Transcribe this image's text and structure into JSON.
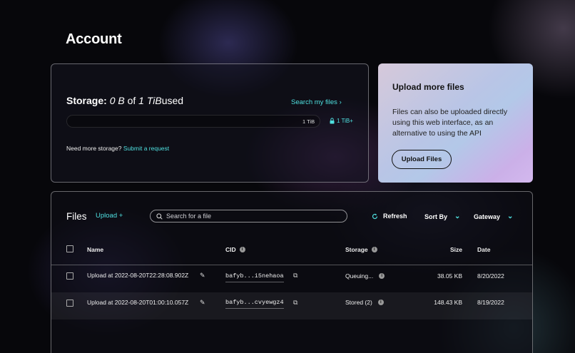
{
  "page": {
    "title": "Account"
  },
  "storage": {
    "label": "Storage:",
    "used": "0 B",
    "of": "of",
    "total": "1 TiB",
    "used_suffix": "used",
    "search_link": "Search my files",
    "search_link_icon": "chevron-right",
    "progress_fraction": 0,
    "cap_label": "1 TiB",
    "upgrade_label": "1 TiB+",
    "upgrade_icon": "lock",
    "need_more_text": "Need more storage?",
    "request_link": "Submit a request"
  },
  "upload_card": {
    "title": "Upload more files",
    "description": "Files can also be uploaded directly using this web interface, as an alternative to using the API",
    "button_label": "Upload Files"
  },
  "files": {
    "title": "Files",
    "upload_link": "Upload +",
    "search_placeholder": "Search for a file",
    "refresh_label": "Refresh",
    "sort_label": "Sort By",
    "gateway_label": "Gateway",
    "columns": {
      "name": "Name",
      "cid": "CID",
      "storage": "Storage",
      "size": "Size",
      "date": "Date"
    },
    "rows": [
      {
        "name": "Upload at 2022-08-20T22:28:08.902Z",
        "cid": "bafyb...i5nehaoa",
        "storage": "Queuing...",
        "size": "38.05 KB",
        "date": "8/20/2022"
      },
      {
        "name": "Upload at 2022-08-20T01:00:10.057Z",
        "cid": "bafyb...cvyewgz4",
        "storage": "Stored (2)",
        "size": "148.43 KB",
        "date": "8/19/2022"
      }
    ]
  },
  "colors": {
    "accent": "#4fe0e0",
    "background": "#07070b",
    "upload_card_gradient_start": "#d6c9da",
    "upload_card_gradient_end": "#d3b8ee"
  }
}
